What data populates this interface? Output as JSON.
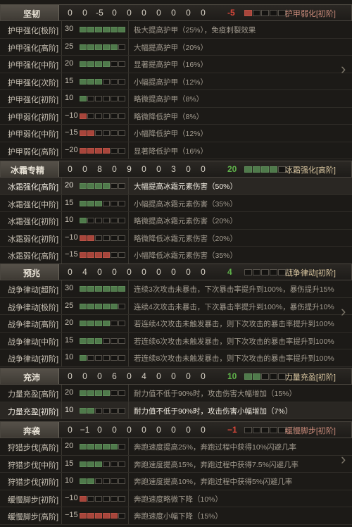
{
  "colors": {
    "green": "#4f7a4b",
    "red": "#a8453b",
    "pos_score": "#5fb24a",
    "neg_score": "#d9473a",
    "level": "#d9c6a0"
  },
  "sections": [
    {
      "title": "坚韧",
      "nums": [
        "0",
        "0",
        "-5",
        "0",
        "0",
        "0",
        "0",
        "0",
        "0",
        "0"
      ],
      "score": "-5",
      "score_sign": "neg",
      "level": "护甲弱化[初阶]",
      "level_sign": "neg",
      "level_fill": 1,
      "rows": [
        {
          "name": "护甲强化[极阶]",
          "val": "30",
          "fill": 6,
          "sign": "pos",
          "desc": "极大提高护甲（25%），免疫刺裂效果"
        },
        {
          "name": "护甲强化[高阶]",
          "val": "25",
          "fill": 5,
          "sign": "pos",
          "desc": "大幅提高护甲（20%）"
        },
        {
          "name": "护甲强化[中阶]",
          "val": "20",
          "fill": 4,
          "sign": "pos",
          "desc": "显著提高护甲（16%）"
        },
        {
          "name": "护甲强化[次阶]",
          "val": "15",
          "fill": 3,
          "sign": "pos",
          "desc": "小幅提高护甲（12%）"
        },
        {
          "name": "护甲强化[初阶]",
          "val": "10",
          "fill": 1,
          "sign": "pos",
          "desc": "略微提高护甲（8%）"
        },
        {
          "name": "护甲弱化[初阶]",
          "val": "−10",
          "fill": 1,
          "sign": "neg",
          "desc": "略微降低护甲（8%）"
        },
        {
          "name": "护甲弱化[中阶]",
          "val": "−15",
          "fill": 2,
          "sign": "neg",
          "desc": "小幅降低护甲（12%）"
        },
        {
          "name": "护甲弱化[高阶]",
          "val": "−20",
          "fill": 4,
          "sign": "neg",
          "desc": "显著降低护甲（16%）"
        }
      ]
    },
    {
      "title": "冰霜专精",
      "nums": [
        "0",
        "0",
        "8",
        "0",
        "9",
        "0",
        "0",
        "3",
        "0",
        "0"
      ],
      "score": "20",
      "score_sign": "pos",
      "level": "冰霜强化[高阶]",
      "level_sign": "pos",
      "level_fill": 4,
      "rows": [
        {
          "name": "冰霜强化[高阶]",
          "val": "20",
          "fill": 4,
          "sign": "pos",
          "desc": "大幅提高冰霜元素伤害（50%）",
          "bright": true
        },
        {
          "name": "冰霜强化[中阶]",
          "val": "15",
          "fill": 3,
          "sign": "pos",
          "desc": "小幅提高冰霜元素伤害（35%）"
        },
        {
          "name": "冰霜强化[初阶]",
          "val": "10",
          "fill": 1,
          "sign": "pos",
          "desc": "略微提高冰霜元素伤害（20%）"
        },
        {
          "name": "冰霜弱化[初阶]",
          "val": "−10",
          "fill": 2,
          "sign": "neg",
          "desc": "略微降低冰霜元素伤害（20%）"
        },
        {
          "name": "冰霜弱化[高阶]",
          "val": "−15",
          "fill": 4,
          "sign": "neg",
          "desc": "小幅降低冰霜元素伤害（35%）"
        }
      ]
    },
    {
      "title": "预兆",
      "nums": [
        "0",
        "4",
        "0",
        "0",
        "0",
        "0",
        "0",
        "0",
        "0",
        "0"
      ],
      "score": "4",
      "score_sign": "pos",
      "level": "战争律动[初阶]",
      "level_sign": "pos",
      "level_fill": 0,
      "rows": [
        {
          "name": "战争律动[超阶]",
          "val": "30",
          "fill": 6,
          "sign": "pos",
          "desc": "连续3次攻击未暴击，下次暴击率提升到100%，暴伤提升15%"
        },
        {
          "name": "战争律动[极阶]",
          "val": "25",
          "fill": 5,
          "sign": "pos",
          "desc": "连续4次攻击未暴击，下次暴击率提升到100%，暴伤提升10%"
        },
        {
          "name": "战争律动[高阶]",
          "val": "20",
          "fill": 4,
          "sign": "pos",
          "desc": "若连续4次攻击未触发暴击，则下次攻击的暴击率提升到100%"
        },
        {
          "name": "战争律动[中阶]",
          "val": "15",
          "fill": 3,
          "sign": "pos",
          "desc": "若连续6次攻击未触发暴击，则下次攻击的暴击率提升到100%"
        },
        {
          "name": "战争律动[初阶]",
          "val": "10",
          "fill": 1,
          "sign": "pos",
          "desc": "若连续8次攻击未触发暴击，则下次攻击的暴击率提升到100%"
        }
      ]
    },
    {
      "title": "充沛",
      "nums": [
        "0",
        "0",
        "0",
        "6",
        "0",
        "4",
        "0",
        "0",
        "0",
        "0"
      ],
      "score": "10",
      "score_sign": "pos",
      "level": "力量充盈[初阶]",
      "level_sign": "pos",
      "level_fill": 2,
      "rows": [
        {
          "name": "力量充盈[高阶]",
          "val": "20",
          "fill": 4,
          "sign": "pos",
          "desc": "耐力值不低于90%时，攻击伤害大幅增加（15%）"
        },
        {
          "name": "力量充盈[初阶]",
          "val": "10",
          "fill": 2,
          "sign": "pos",
          "desc": "耐力值不低于90%时，攻击伤害小幅增加（7%）",
          "bright": true
        }
      ]
    },
    {
      "title": "奔袭",
      "nums": [
        "0",
        "−1",
        "0",
        "0",
        "0",
        "0",
        "0",
        "0",
        "0",
        "0"
      ],
      "score": "−1",
      "score_sign": "neg",
      "level": "缓慢脚步[初阶]",
      "level_sign": "neg",
      "level_fill": 0,
      "rows": [
        {
          "name": "狩猎步伐[高阶]",
          "val": "20",
          "fill": 5,
          "sign": "pos",
          "desc": "奔跑速度提高25%，奔跑过程中获得10%闪避几率"
        },
        {
          "name": "狩猎步伐[中阶]",
          "val": "15",
          "fill": 3,
          "sign": "pos",
          "desc": "奔跑速度提高15%，奔跑过程中获得7.5%闪避几率"
        },
        {
          "name": "狩猎步伐[初阶]",
          "val": "10",
          "fill": 2,
          "sign": "pos",
          "desc": "奔跑速度提高10%，奔跑过程中获得5%闪避几率"
        },
        {
          "name": "缓慢脚步[初阶]",
          "val": "−10",
          "fill": 1,
          "sign": "neg",
          "desc": "奔跑速度略微下降（10%）"
        },
        {
          "name": "缓慢脚步[高阶]",
          "val": "−15",
          "fill": 5,
          "sign": "neg",
          "desc": "奔跑速度小幅下降（15%）"
        }
      ]
    }
  ]
}
